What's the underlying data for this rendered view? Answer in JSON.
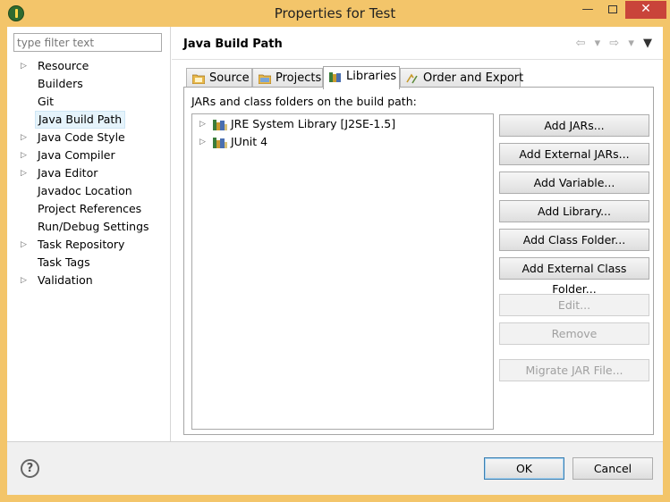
{
  "window": {
    "title": "Properties for Test",
    "minimize": "—",
    "close": "✕"
  },
  "filter": {
    "placeholder": "type filter text"
  },
  "tree": [
    {
      "label": "Resource",
      "expandable": true
    },
    {
      "label": "Builders",
      "expandable": false
    },
    {
      "label": "Git",
      "expandable": false
    },
    {
      "label": "Java Build Path",
      "expandable": false,
      "selected": true
    },
    {
      "label": "Java Code Style",
      "expandable": true
    },
    {
      "label": "Java Compiler",
      "expandable": true
    },
    {
      "label": "Java Editor",
      "expandable": true
    },
    {
      "label": "Javadoc Location",
      "expandable": false
    },
    {
      "label": "Project References",
      "expandable": false
    },
    {
      "label": "Run/Debug Settings",
      "expandable": false
    },
    {
      "label": "Task Repository",
      "expandable": true
    },
    {
      "label": "Task Tags",
      "expandable": false
    },
    {
      "label": "Validation",
      "expandable": true
    }
  ],
  "page": {
    "title": "Java Build Path"
  },
  "tabs": [
    {
      "label": "Source",
      "icon": "source-folder-icon"
    },
    {
      "label": "Projects",
      "icon": "projects-folder-icon"
    },
    {
      "label": "Libraries",
      "icon": "library-icon",
      "active": true
    },
    {
      "label": "Order and Export",
      "icon": "order-export-icon"
    }
  ],
  "libraries": {
    "heading": "JARs and class folders on the build path:",
    "items": [
      {
        "label": "JRE System Library [J2SE-1.5]"
      },
      {
        "label": "JUnit 4"
      }
    ]
  },
  "buttons": {
    "add_jars": "Add JARs...",
    "add_external_jars": "Add External JARs...",
    "add_variable": "Add Variable...",
    "add_library": "Add Library...",
    "add_class_folder": "Add Class Folder...",
    "add_external_class_folder": "Add External Class Folder...",
    "edit": "Edit...",
    "remove": "Remove",
    "migrate_jar": "Migrate JAR File..."
  },
  "footer": {
    "help": "?",
    "ok": "OK",
    "cancel": "Cancel"
  },
  "colors": {
    "titlebar": "#f3c56a",
    "close": "#c9443a",
    "selection": "#e5f3fb"
  }
}
